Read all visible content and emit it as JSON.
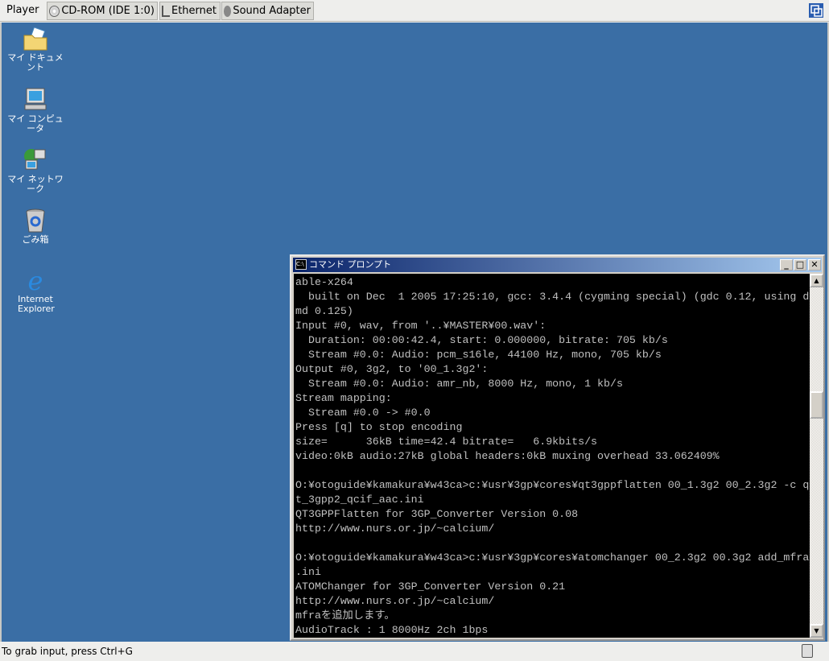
{
  "toolbar": {
    "menu_label": "Player",
    "devices": [
      {
        "label": "CD-ROM (IDE 1:0)",
        "icon": "cdrom-icon"
      },
      {
        "label": "Ethernet",
        "icon": "network-icon"
      },
      {
        "label": "Sound Adapter",
        "icon": "sound-icon"
      }
    ]
  },
  "desktop": {
    "background": "#3a6ea5",
    "icons": [
      {
        "label": "マイ ドキュメント",
        "icon": "folder-documents-icon"
      },
      {
        "label": "マイ コンピュータ",
        "icon": "computer-icon"
      },
      {
        "label": "マイ ネットワーク",
        "icon": "network-places-icon"
      },
      {
        "label": "ごみ箱",
        "icon": "recycle-bin-icon"
      },
      {
        "label": "Internet Explorer",
        "icon": "internet-explorer-icon"
      }
    ]
  },
  "cmd_window": {
    "title": "コマンド プロンプト",
    "icon_text": "C:\\",
    "minimize": "_",
    "maximize": "□",
    "close": "✕",
    "lines": [
      "able-x264",
      "  built on Dec  1 2005 17:25:10, gcc: 3.4.4 (cygming special) (gdc 0.12, using d",
      "md 0.125)",
      "Input #0, wav, from '..¥MASTER¥00.wav':",
      "  Duration: 00:00:42.4, start: 0.000000, bitrate: 705 kb/s",
      "  Stream #0.0: Audio: pcm_s16le, 44100 Hz, mono, 705 kb/s",
      "Output #0, 3g2, to '00_1.3g2':",
      "  Stream #0.0: Audio: amr_nb, 8000 Hz, mono, 1 kb/s",
      "Stream mapping:",
      "  Stream #0.0 -> #0.0",
      "Press [q] to stop encoding",
      "size=      36kB time=42.4 bitrate=   6.9kbits/s",
      "video:0kB audio:27kB global headers:0kB muxing overhead 33.062409%",
      "",
      "O:¥otoguide¥kamakura¥w43ca>c:¥usr¥3gp¥cores¥qt3gppflatten 00_1.3g2 00_2.3g2 -c q",
      "t_3gpp2_qcif_aac.ini",
      "QT3GPPFlatten for 3GP_Converter Version 0.08",
      "http://www.nurs.or.jp/~calcium/",
      "",
      "O:¥otoguide¥kamakura¥w43ca>c:¥usr¥3gp¥cores¥atomchanger 00_2.3g2 00.3g2 add_mfra",
      ".ini",
      "ATOMChanger for 3GP_Converter Version 0.21",
      "http://www.nurs.or.jp/~calcium/",
      "mfraを追加します。",
      "AudioTrack : 1 8000Hz 2ch 1bps"
    ]
  },
  "status": {
    "text": "To grab input, press Ctrl+G"
  }
}
